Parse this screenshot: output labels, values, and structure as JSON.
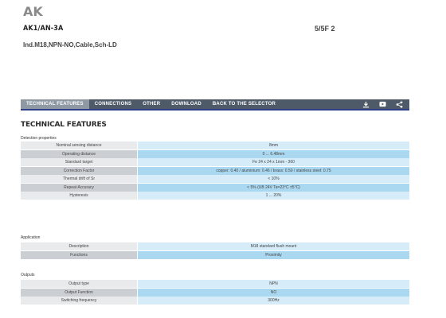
{
  "header": {
    "brand": "AK",
    "model": "AK1/AN-3A",
    "model_suffix": "5/5F 2",
    "subtitle": "Ind.M18,NPN-NO,Cable,Sch-LD"
  },
  "tabs": [
    {
      "label": "TECHNICAL FEATURES",
      "active": true
    },
    {
      "label": "CONNECTIONS",
      "active": false
    },
    {
      "label": "OTHER",
      "active": false
    },
    {
      "label": "DOWNLOAD",
      "active": false
    },
    {
      "label": "BACK TO THE SELECTOR",
      "active": false
    }
  ],
  "tab_icons": [
    "download-icon",
    "youtube-icon",
    "share-icon"
  ],
  "section_title": "TECHNICAL FEATURES",
  "groups": [
    {
      "label": "Detection properties",
      "rows": [
        {
          "name": "Nominal sensing distance",
          "value": "8mm"
        },
        {
          "name": "Operating distance",
          "value": "0 ... 6.48mm"
        },
        {
          "name": "Standard target",
          "value": "Fe 24 x 24 x 1mm - 360"
        },
        {
          "name": "Correction Factor",
          "value": "copper: 0.40 / aluminium: 0.46 / brass: 0.50 / stainless steel: 0.75"
        },
        {
          "name": "Thermal drift of Sr",
          "value": "< 10%"
        },
        {
          "name": "Repeat Accuracy",
          "value": "< 5% (UB 24V Ta=23°C ±5°C)"
        },
        {
          "name": "Hysteresis",
          "value": "1 ... 20%"
        }
      ]
    },
    {
      "label": "Application",
      "rows": [
        {
          "name": "Description",
          "value": "M18 standard flush mount"
        },
        {
          "name": "Functions",
          "value": "Proximity"
        }
      ]
    },
    {
      "label": "Outputs",
      "rows": [
        {
          "name": "Output type",
          "value": "NPN"
        },
        {
          "name": "Output Function",
          "value": "NO"
        },
        {
          "name": "Switching frequency",
          "value": "300Hz"
        }
      ]
    }
  ],
  "colors": {
    "tabbar": "#4e5a68",
    "tab_active": "#8e99a4",
    "tab_underline": "#2f3f8a",
    "label_light": "#e8eaec",
    "label_dark": "#cbcfd3",
    "value_light": "#d6ecf8",
    "value_dark": "#a9d8f0"
  }
}
